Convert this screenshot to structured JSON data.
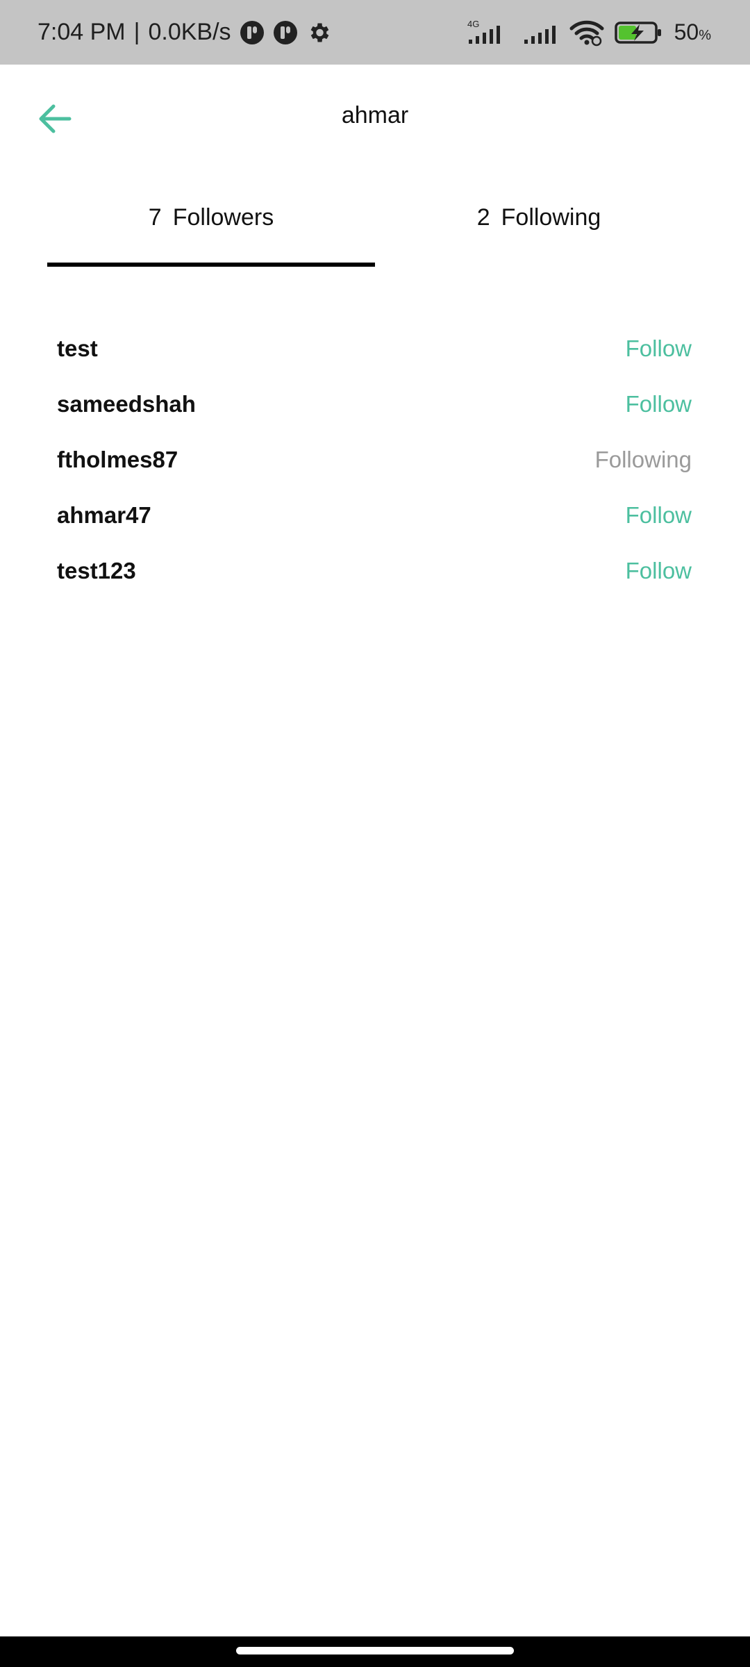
{
  "status_bar": {
    "time": "7:04 PM",
    "separator": "|",
    "speed": "0.0KB/s",
    "network_label": "4G",
    "battery": "50",
    "battery_unit": "%"
  },
  "header": {
    "title": "ahmar"
  },
  "tabs": {
    "followers": {
      "count": "7",
      "label": "Followers"
    },
    "following": {
      "count": "2",
      "label": "Following"
    }
  },
  "users": [
    {
      "name": "test",
      "action": "Follow",
      "state": "follow"
    },
    {
      "name": "sameedshah",
      "action": "Follow",
      "state": "follow"
    },
    {
      "name": "ftholmes87",
      "action": "Following",
      "state": "following"
    },
    {
      "name": "ahmar47",
      "action": "Follow",
      "state": "follow"
    },
    {
      "name": "test123",
      "action": "Follow",
      "state": "follow"
    }
  ],
  "colors": {
    "accent": "#4cbf9f",
    "muted": "#9a9a9a",
    "status_bar_bg": "#c4c4c4",
    "battery_charge": "#54c22f"
  },
  "icons": {
    "back": "arrow-left-icon",
    "settings": "gear-icon",
    "signal": "signal-bars-icon",
    "wifi": "wifi-icon",
    "battery": "battery-charging-icon"
  }
}
